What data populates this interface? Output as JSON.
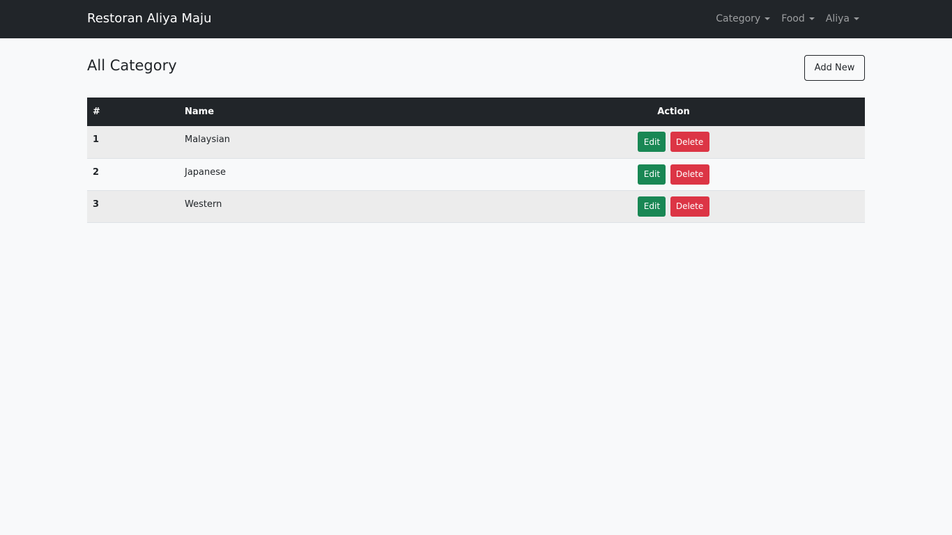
{
  "navbar": {
    "brand": "Restoran Aliya Maju",
    "menu": [
      {
        "label": "Category"
      },
      {
        "label": "Food"
      },
      {
        "label": "Aliya"
      }
    ]
  },
  "page": {
    "title": "All Category",
    "add_button": "Add New"
  },
  "table": {
    "headers": [
      "#",
      "Name",
      "Action"
    ],
    "rows": [
      {
        "num": "1",
        "name": "Malaysian",
        "edit": "Edit",
        "delete": "Delete"
      },
      {
        "num": "2",
        "name": "Japanese",
        "edit": "Edit",
        "delete": "Delete"
      },
      {
        "num": "3",
        "name": "Western",
        "edit": "Edit",
        "delete": "Delete"
      }
    ]
  },
  "colors": {
    "navbar": "#212529",
    "edit": "#198754",
    "delete": "#dc3545",
    "background": "#f8f9fa"
  }
}
